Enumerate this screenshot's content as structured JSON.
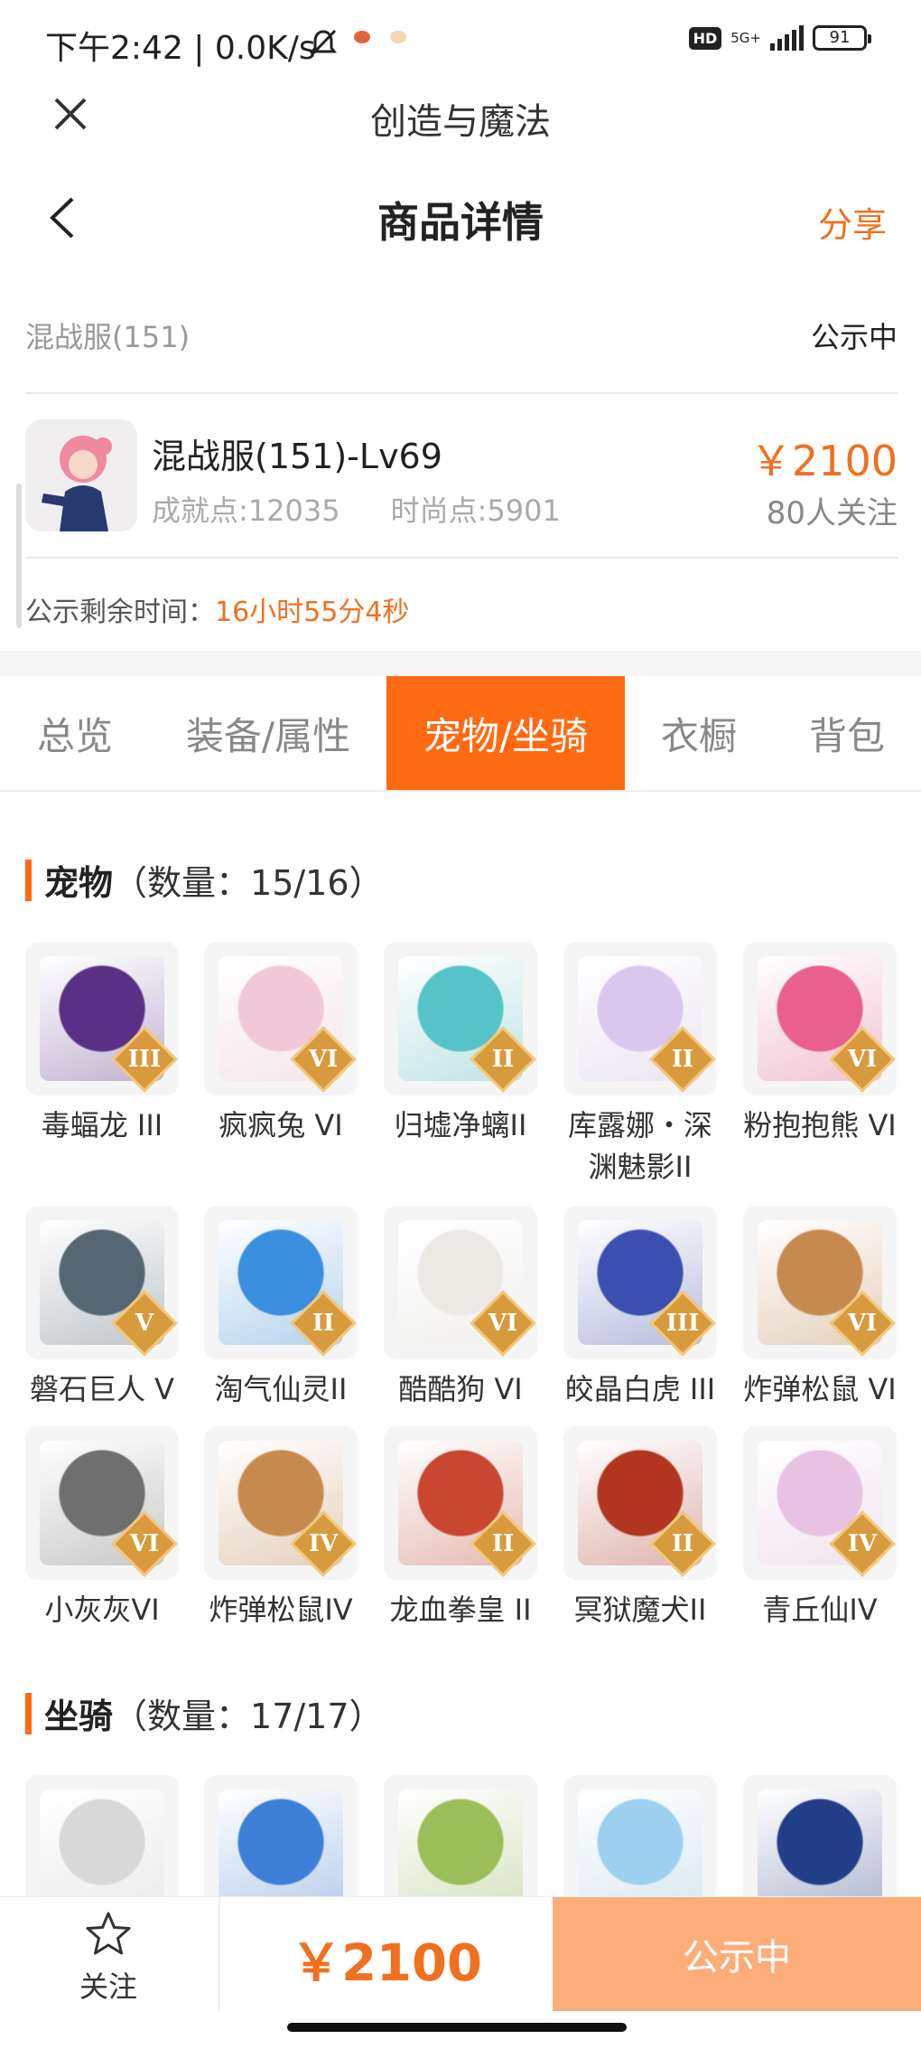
{
  "status_bar": {
    "time_speed": "下午2:42 | 0.0K/s",
    "hd": "HD",
    "network": "5G+",
    "battery": "91",
    "colors": [
      "#e2643a",
      "#f3d7b0"
    ]
  },
  "app": {
    "title": "创造与魔法",
    "close_icon": "close-icon"
  },
  "page": {
    "title": "商品详情",
    "share": "分享",
    "back_icon": "chevron-left-icon"
  },
  "listing": {
    "server": "混战服(151)",
    "state": "公示中",
    "character_name": "混战服(151)-Lv69",
    "achievement": "成就点:12035",
    "fashion": "时尚点:5901",
    "price": "￥2100",
    "followers": "80人关注",
    "countdown_label": "公示剩余时间：",
    "countdown_value": "16小时55分4秒"
  },
  "tabs": [
    {
      "label": "总览",
      "active": false
    },
    {
      "label": "装备/属性",
      "active": false
    },
    {
      "label": "宠物/坐骑",
      "active": true
    },
    {
      "label": "衣橱",
      "active": false
    },
    {
      "label": "背包",
      "active": false
    }
  ],
  "pets": {
    "title": "宠物",
    "count": "（数量：15/16）",
    "items": [
      {
        "name": "毒蝠龙 III",
        "rank": "III",
        "color": "#5a2f86"
      },
      {
        "name": "疯疯兔 VI",
        "rank": "VI",
        "color": "#f2c7d8"
      },
      {
        "name": "归墟净螭II",
        "rank": "II",
        "color": "#55c3c8"
      },
      {
        "name": "库露娜・深渊魅影II",
        "rank": "II",
        "color": "#d9c7ee"
      },
      {
        "name": "粉抱抱熊 VI",
        "rank": "VI",
        "color": "#e95f8e"
      },
      {
        "name": "磐石巨人 V",
        "rank": "V",
        "color": "#566774"
      },
      {
        "name": "淘气仙灵II",
        "rank": "II",
        "color": "#3b8fe0"
      },
      {
        "name": "酷酷狗 VI",
        "rank": "VI",
        "color": "#ece9e4"
      },
      {
        "name": "皎晶白虎 III",
        "rank": "III",
        "color": "#3b4fb0"
      },
      {
        "name": "炸弹松鼠 VI",
        "rank": "VI",
        "color": "#c78a4e"
      },
      {
        "name": "小灰灰VI",
        "rank": "VI",
        "color": "#6f6f70"
      },
      {
        "name": "炸弹松鼠IV",
        "rank": "IV",
        "color": "#c78a4e"
      },
      {
        "name": "龙血拳皇 II",
        "rank": "II",
        "color": "#c9462f"
      },
      {
        "name": "冥狱魔犬II",
        "rank": "II",
        "color": "#b23520"
      },
      {
        "name": "青丘仙IV",
        "rank": "IV",
        "color": "#e8c2e3"
      }
    ]
  },
  "mounts": {
    "title": "坐骑",
    "count": "（数量：17/17）",
    "items": [
      {
        "color": "#d8d8d8"
      },
      {
        "color": "#3d7fd7"
      },
      {
        "color": "#9abf59"
      },
      {
        "color": "#9ed0f0"
      },
      {
        "color": "#233e88"
      }
    ]
  },
  "bottom": {
    "follow_label": "关注",
    "price": "￥2100",
    "action": "公示中"
  }
}
